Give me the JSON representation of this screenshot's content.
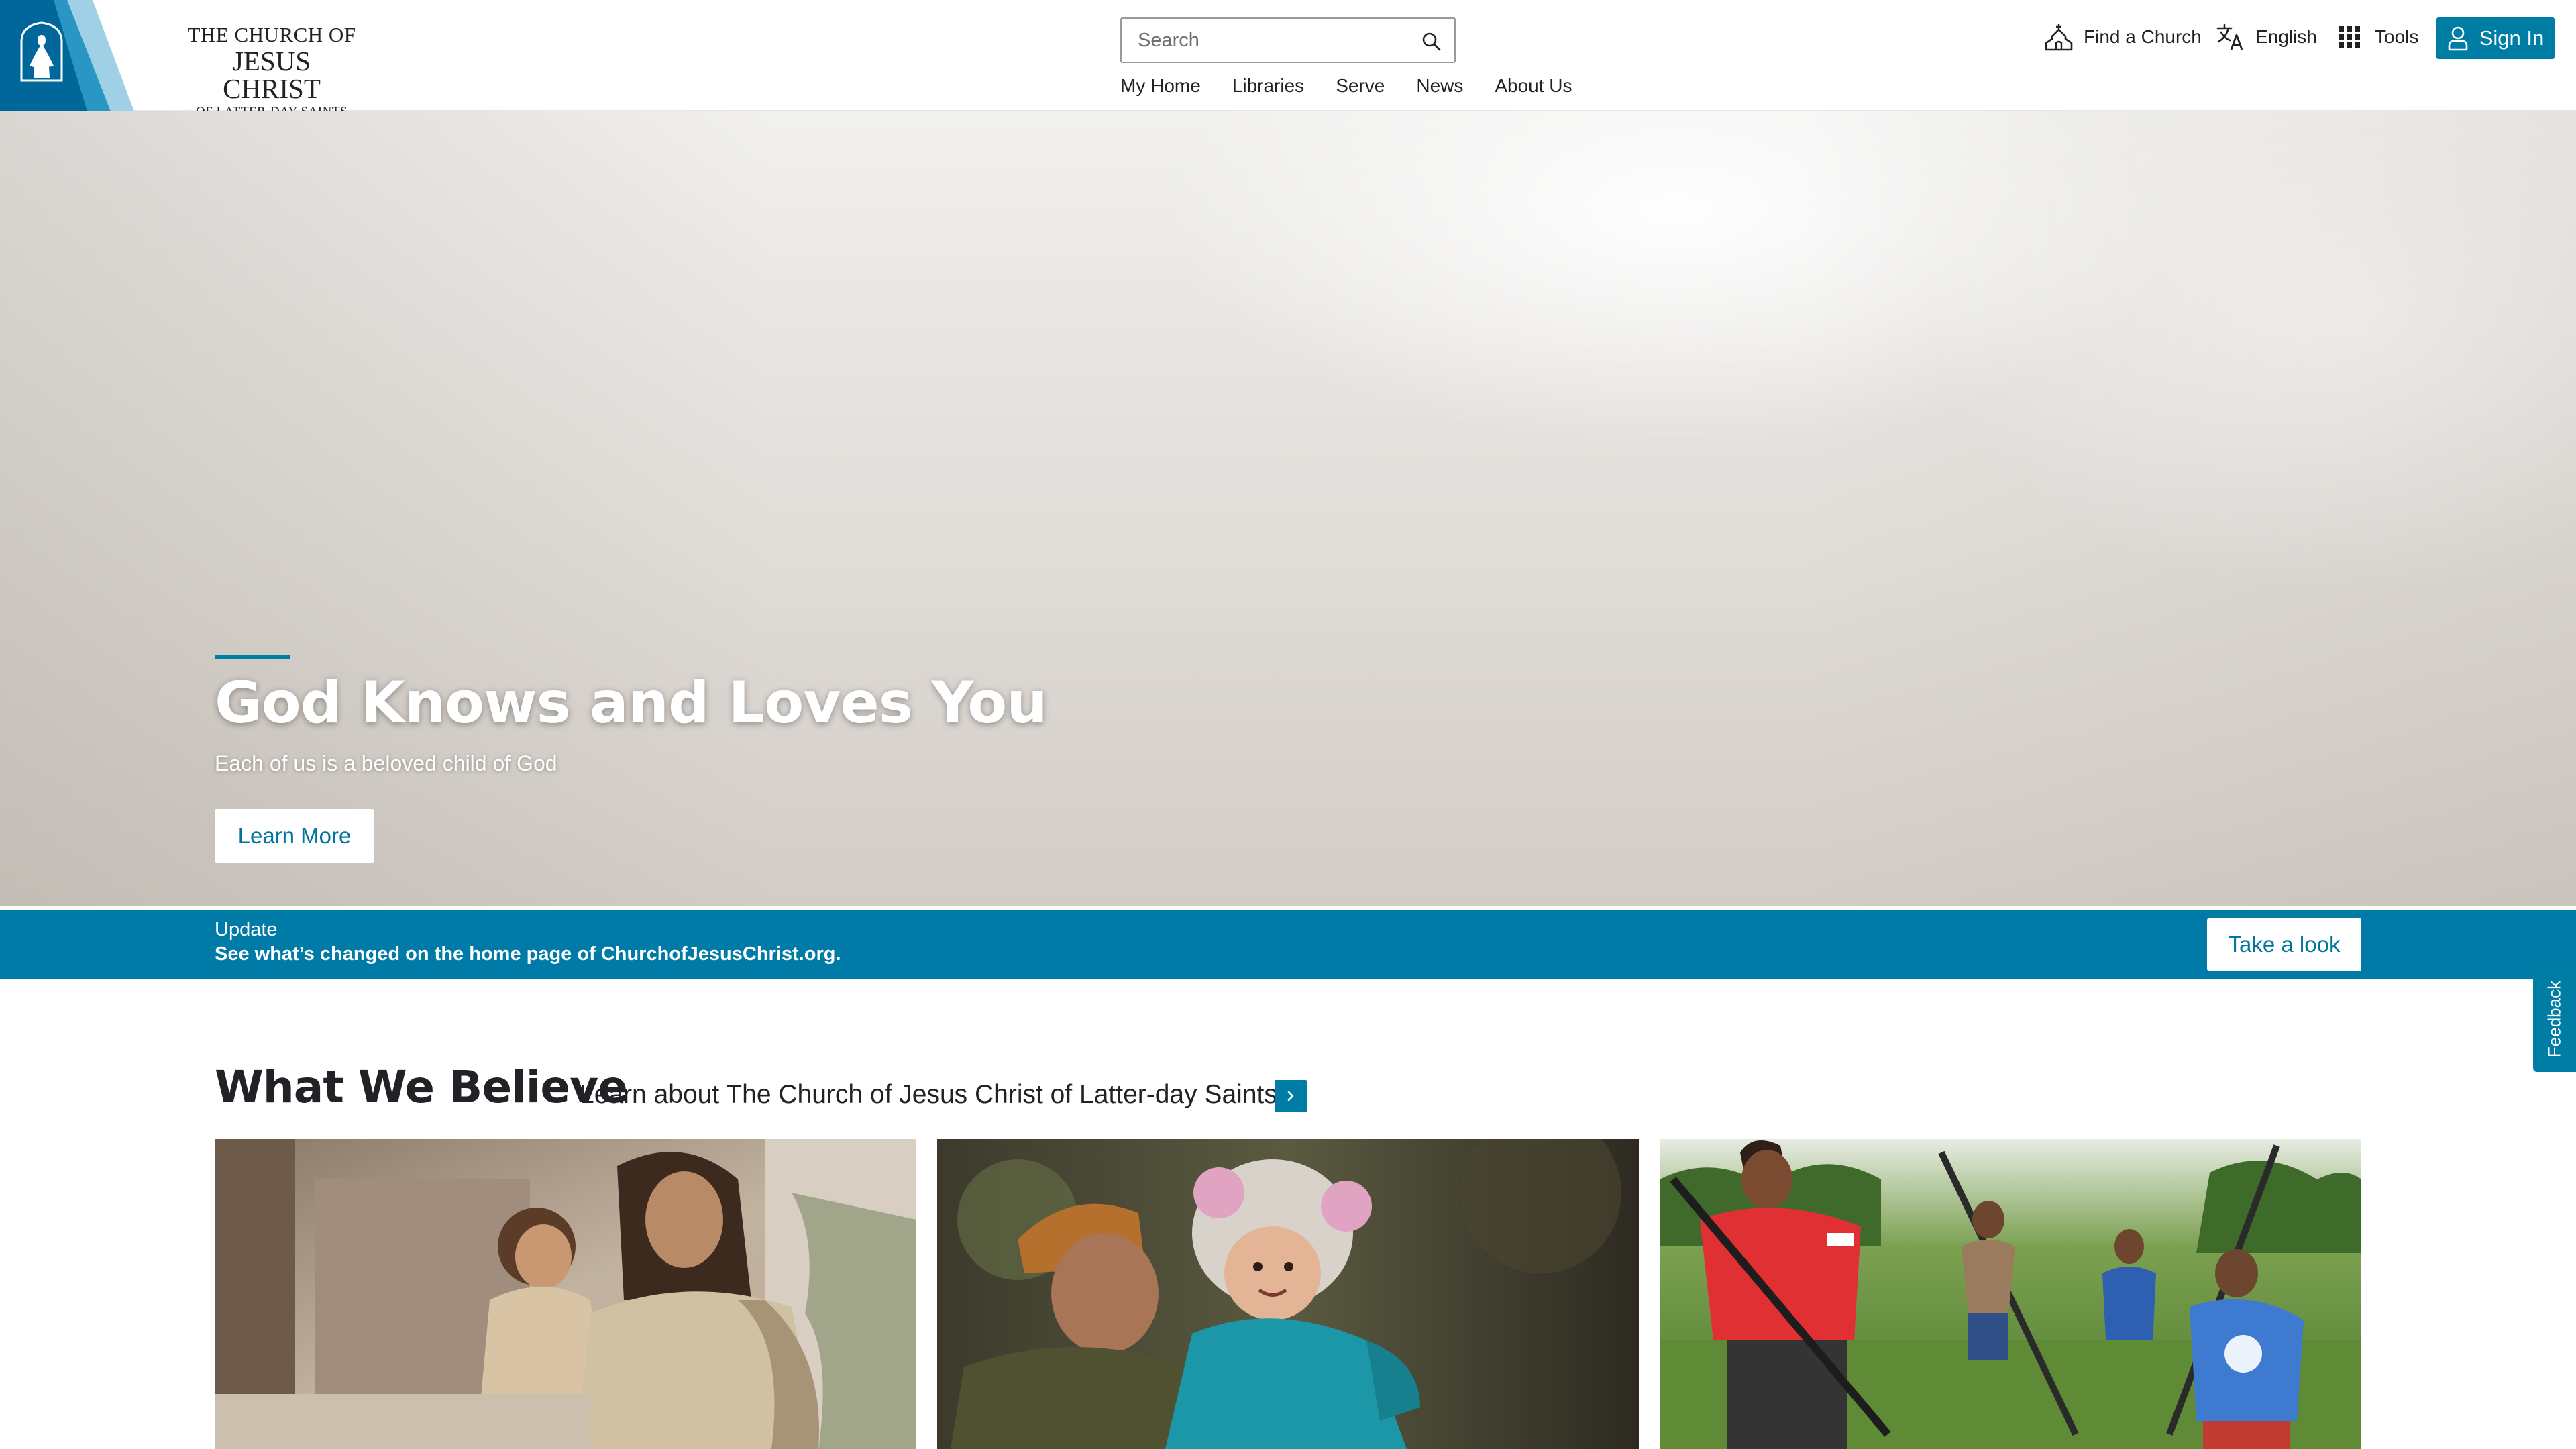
{
  "header": {
    "logo": {
      "line1": "THE CHURCH OF",
      "line2": "JESUS CHRIST",
      "line3": "OF LATTER-DAY SAINTS"
    },
    "search": {
      "placeholder": "Search"
    },
    "nav": [
      "My Home",
      "Libraries",
      "Serve",
      "News",
      "About Us"
    ],
    "utilities": {
      "find_church": "Find a Church",
      "language": "English",
      "tools": "Tools",
      "sign_in": "Sign In"
    }
  },
  "hero": {
    "title": "God Knows and Loves You",
    "subtitle": "Each of us is a beloved child of God",
    "button": "Learn More"
  },
  "update_banner": {
    "label": "Update",
    "text": "See what’s changed on the home page of ChurchofJesusChrist.org.",
    "button": "Take a look"
  },
  "feedback": {
    "label": "Feedback"
  },
  "believe": {
    "title": "What We Believe",
    "subtitle": "Learn about The Church of Jesus Christ of Latter-day Saints"
  },
  "colors": {
    "brand_blue": "#007da5",
    "banner_blue": "#007ba7",
    "text": "#212225"
  }
}
